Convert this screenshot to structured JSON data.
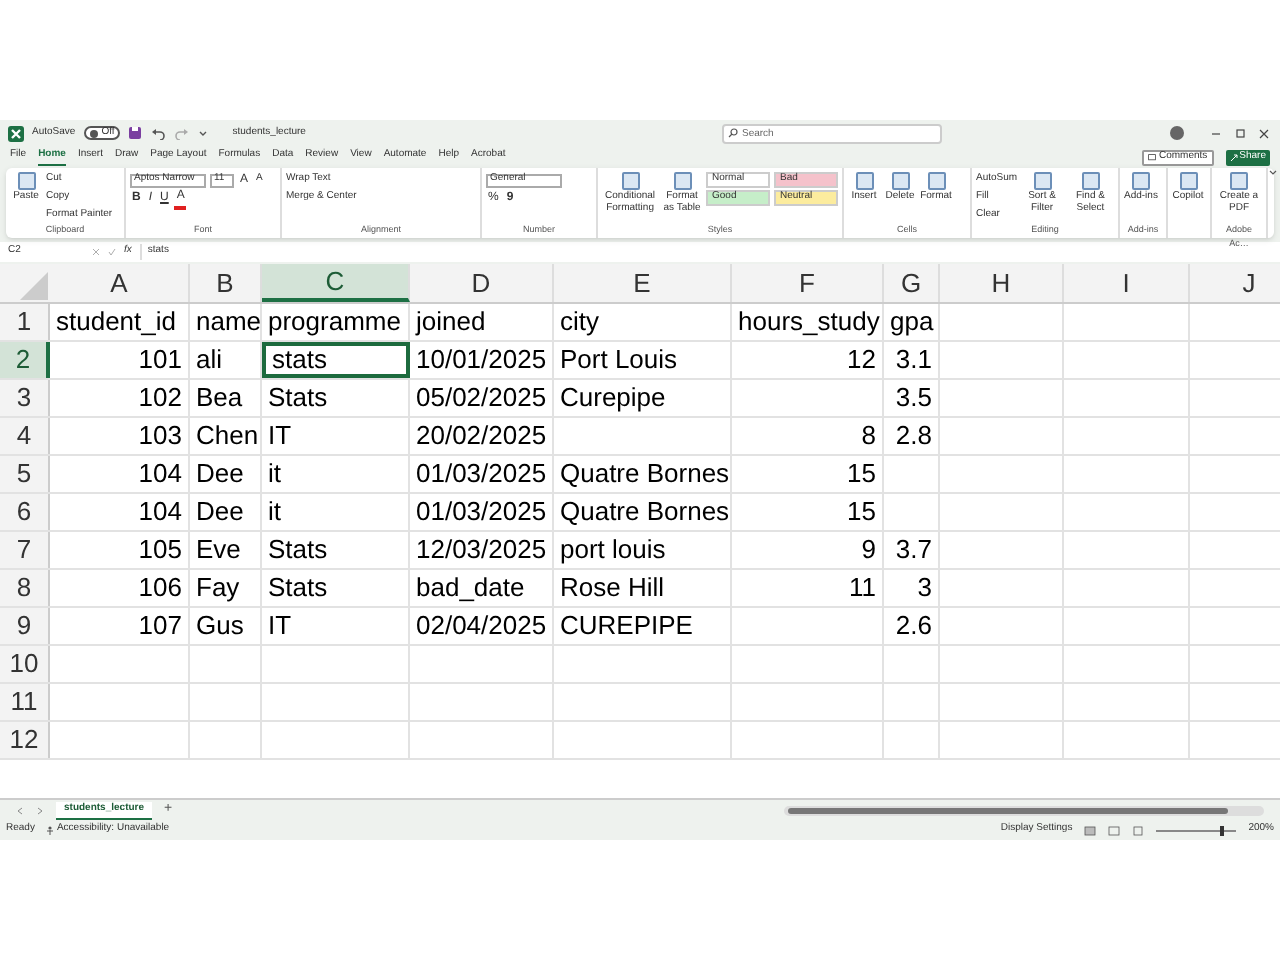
{
  "title_bar": {
    "autosave_label": "AutoSave",
    "autosave_toggle": {
      "label": "Off",
      "on": false
    },
    "file_name": "students_lecture",
    "search": {
      "placeholder": "Search"
    }
  },
  "menu_tabs": [
    {
      "label": "File",
      "selected": false
    },
    {
      "label": "Home",
      "selected": true
    },
    {
      "label": "Insert",
      "selected": false
    },
    {
      "label": "Draw",
      "selected": false
    },
    {
      "label": "Page Layout",
      "selected": false
    },
    {
      "label": "Formulas",
      "selected": false
    },
    {
      "label": "Data",
      "selected": false
    },
    {
      "label": "Review",
      "selected": false
    },
    {
      "label": "View",
      "selected": false
    },
    {
      "label": "Automate",
      "selected": false
    },
    {
      "label": "Help",
      "selected": false
    },
    {
      "label": "Acrobat",
      "selected": false
    }
  ],
  "comments_button": "Comments",
  "share_button": "Share",
  "ribbon_groups": [
    {
      "label": "Clipboard",
      "parts": [
        {
          "kind": "large",
          "label": "Paste"
        },
        {
          "kind": "stack",
          "lines": [
            {
              "items": [
                {
                  "kind": "button",
                  "label": "Cut"
                }
              ]
            },
            {
              "items": [
                {
                  "kind": "button",
                  "label": "Copy"
                }
              ]
            },
            {
              "items": [
                {
                  "kind": "button",
                  "label": "Format Painter"
                }
              ]
            }
          ]
        }
      ]
    },
    {
      "label": "Font",
      "parts": [
        {
          "kind": "stack",
          "lines": [
            {
              "items": [
                {
                  "kind": "dropdown",
                  "label": "Aptos Narrow"
                },
                {
                  "kind": "dropdown",
                  "label": "11"
                },
                {
                  "kind": "grow",
                  "label": "A"
                },
                {
                  "kind": "shrink",
                  "label": "A"
                }
              ]
            },
            {
              "items": [
                {
                  "kind": "bold",
                  "label": "B"
                },
                {
                  "kind": "italic",
                  "label": "I"
                },
                {
                  "kind": "underline",
                  "label": "U"
                },
                {
                  "kind": "font_color",
                  "label": "A"
                }
              ]
            }
          ]
        }
      ]
    },
    {
      "label": "Alignment",
      "parts": [
        {
          "kind": "stack",
          "lines": [
            {
              "items": [
                {
                  "kind": "button",
                  "label": "Wrap Text"
                }
              ]
            },
            {
              "items": [
                {
                  "kind": "button",
                  "label": "Merge & Center"
                }
              ]
            }
          ]
        }
      ]
    },
    {
      "label": "Number",
      "parts": [
        {
          "kind": "stack",
          "lines": [
            {
              "items": [
                {
                  "kind": "dropdown",
                  "label": "General"
                }
              ]
            },
            {
              "items": [
                {
                  "kind": "percent",
                  "label": "%"
                },
                {
                  "kind": "comma",
                  "label": "9"
                }
              ]
            }
          ]
        }
      ]
    },
    {
      "label": "Styles",
      "parts": [
        {
          "kind": "large",
          "label": "Conditional Formatting"
        },
        {
          "kind": "large",
          "label": "Format as Table"
        },
        {
          "kind": "stack",
          "lines": [
            {
              "items": [
                {
                  "kind": "style",
                  "label": "Normal",
                  "color": "#ffffff"
                },
                {
                  "kind": "style",
                  "label": "Bad",
                  "color": "#f5c2cb"
                }
              ]
            },
            {
              "items": [
                {
                  "kind": "style",
                  "label": "Good",
                  "color": "#c6eec9"
                },
                {
                  "kind": "style",
                  "label": "Neutral",
                  "color": "#fcec9e"
                }
              ]
            }
          ]
        }
      ]
    },
    {
      "label": "Cells",
      "parts": [
        {
          "kind": "large",
          "label": "Insert"
        },
        {
          "kind": "large",
          "label": "Delete"
        },
        {
          "kind": "large",
          "label": "Format"
        }
      ]
    },
    {
      "label": "Editing",
      "parts": [
        {
          "kind": "stack",
          "lines": [
            {
              "items": [
                {
                  "kind": "button",
                  "label": "AutoSum"
                }
              ]
            },
            {
              "items": [
                {
                  "kind": "button",
                  "label": "Fill"
                }
              ]
            },
            {
              "items": [
                {
                  "kind": "button",
                  "label": "Clear"
                }
              ]
            }
          ]
        },
        {
          "kind": "large",
          "label": "Sort & Filter"
        },
        {
          "kind": "large",
          "label": "Find & Select"
        }
      ]
    },
    {
      "label": "Add-ins",
      "parts": [
        {
          "kind": "large",
          "label": "Add-ins"
        }
      ]
    },
    {
      "parts": [
        {
          "kind": "large",
          "label": "Copilot"
        }
      ]
    },
    {
      "label": "Adobe Ac…",
      "parts": [
        {
          "kind": "large",
          "label": "Create a PDF"
        }
      ]
    }
  ],
  "formula_bar": {
    "name_box": "C2",
    "fx": "fx",
    "formula": "stats"
  },
  "sheet": {
    "columns": [
      {
        "label": "A",
        "selected": false
      },
      {
        "label": "B",
        "selected": false
      },
      {
        "label": "C",
        "selected": true
      },
      {
        "label": "D",
        "selected": false
      },
      {
        "label": "E",
        "selected": false
      },
      {
        "label": "F",
        "selected": false
      },
      {
        "label": "G",
        "selected": false
      },
      {
        "label": "H",
        "selected": false
      },
      {
        "label": "I",
        "selected": false
      },
      {
        "label": "J",
        "selected": false
      }
    ],
    "rows": [
      {
        "number": "1",
        "selected": false,
        "kind": "header",
        "cells": [
          "student_id",
          "name",
          "programme",
          "joined",
          "city",
          "hours_study",
          "gpa"
        ]
      },
      {
        "number": "2",
        "selected": true,
        "kind": "data",
        "cells": [
          "101",
          "ali",
          "stats",
          "10/01/2025",
          "Port Louis",
          "12",
          "3.1"
        ]
      },
      {
        "number": "3",
        "selected": false,
        "kind": "data",
        "cells": [
          "102",
          "Bea",
          "Stats",
          "05/02/2025",
          "Curepipe",
          "",
          "3.5"
        ]
      },
      {
        "number": "4",
        "selected": false,
        "kind": "data",
        "cells": [
          "103",
          "Chen",
          "IT",
          "20/02/2025",
          "",
          "8",
          "2.8"
        ]
      },
      {
        "number": "5",
        "selected": false,
        "kind": "data",
        "cells": [
          "104",
          "Dee",
          "it",
          "01/03/2025",
          "Quatre Bornes",
          "15",
          ""
        ]
      },
      {
        "number": "6",
        "selected": false,
        "kind": "data",
        "cells": [
          "104",
          "Dee",
          "it",
          "01/03/2025",
          "Quatre Bornes",
          "15",
          ""
        ]
      },
      {
        "number": "7",
        "selected": false,
        "kind": "data",
        "cells": [
          "105",
          "Eve",
          "Stats",
          "12/03/2025",
          "port louis",
          "9",
          "3.7"
        ]
      },
      {
        "number": "8",
        "selected": false,
        "kind": "data",
        "cells": [
          "106",
          "Fay",
          "Stats",
          "bad_date",
          "Rose Hill",
          "11",
          "3"
        ]
      },
      {
        "number": "9",
        "selected": false,
        "kind": "data",
        "cells": [
          "107",
          "Gus",
          "IT",
          "02/04/2025",
          "CUREPIPE",
          "",
          "2.6"
        ]
      },
      {
        "number": "10",
        "selected": false
      },
      {
        "number": "11",
        "selected": false
      },
      {
        "number": "12",
        "selected": false
      }
    ]
  },
  "sheet_tabs": [
    {
      "label": "students_lecture",
      "selected": true
    }
  ],
  "add_sheet": "+",
  "status_bar": {
    "ready": "Ready",
    "accessibility": "Accessibility: Unavailable",
    "display_settings": "Display Settings",
    "zoom": {
      "level": 0.8,
      "reading": "200%"
    }
  }
}
